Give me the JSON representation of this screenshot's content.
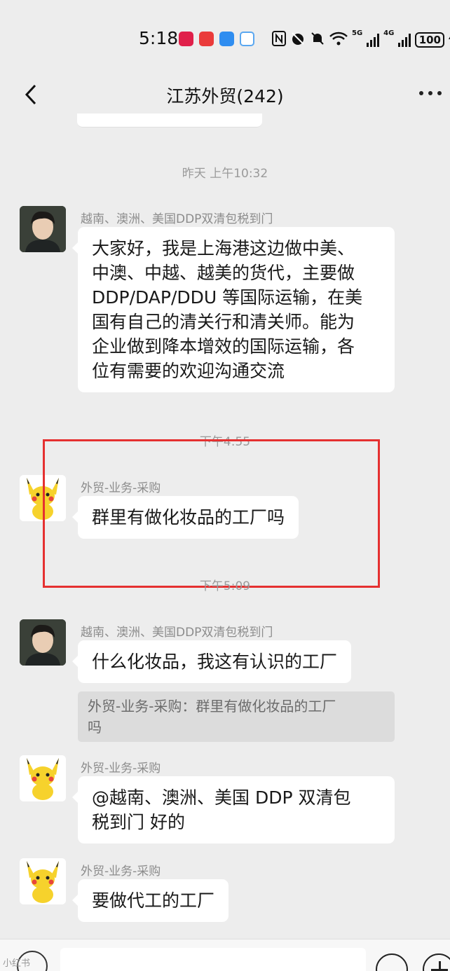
{
  "status_bar": {
    "time": "5:18",
    "network_tags": [
      "5G",
      "4G"
    ],
    "battery": "100"
  },
  "header": {
    "title": "江苏外贸(242)"
  },
  "messages": [
    {
      "time_label": "昨天 上午10:32",
      "sender": "越南、澳洲、美国DDP双清包税到门",
      "lines": [
        "大家好，我是上海港这边做中美、",
        "中澳、中越、越美的货代，主要做",
        "DDP/DAP/DDU 等国际运输，在美",
        "国有自己的清关行和清关师。能为",
        "企业做到降本增效的国际运输，各",
        "位有需要的欢迎沟通交流"
      ]
    },
    {
      "time_label": "下午4:55",
      "sender": "外贸-业务-采购",
      "text": "群里有做化妆品的工厂吗"
    },
    {
      "time_label": "下午5:09",
      "sender": "越南、澳洲、美国DDP双清包税到门",
      "text": "什么化妆品，我这有认识的工厂",
      "quote_lines": [
        "外贸-业务-采购：群里有做化妆品的工厂",
        "吗"
      ]
    },
    {
      "sender": "外贸-业务-采购",
      "lines": [
        "@越南、澳洲、美国 DDP 双清包",
        "税到门  好的"
      ]
    },
    {
      "sender": "外贸-业务-采购",
      "text": "要做代工的工厂"
    }
  ],
  "watermark": "小红书"
}
